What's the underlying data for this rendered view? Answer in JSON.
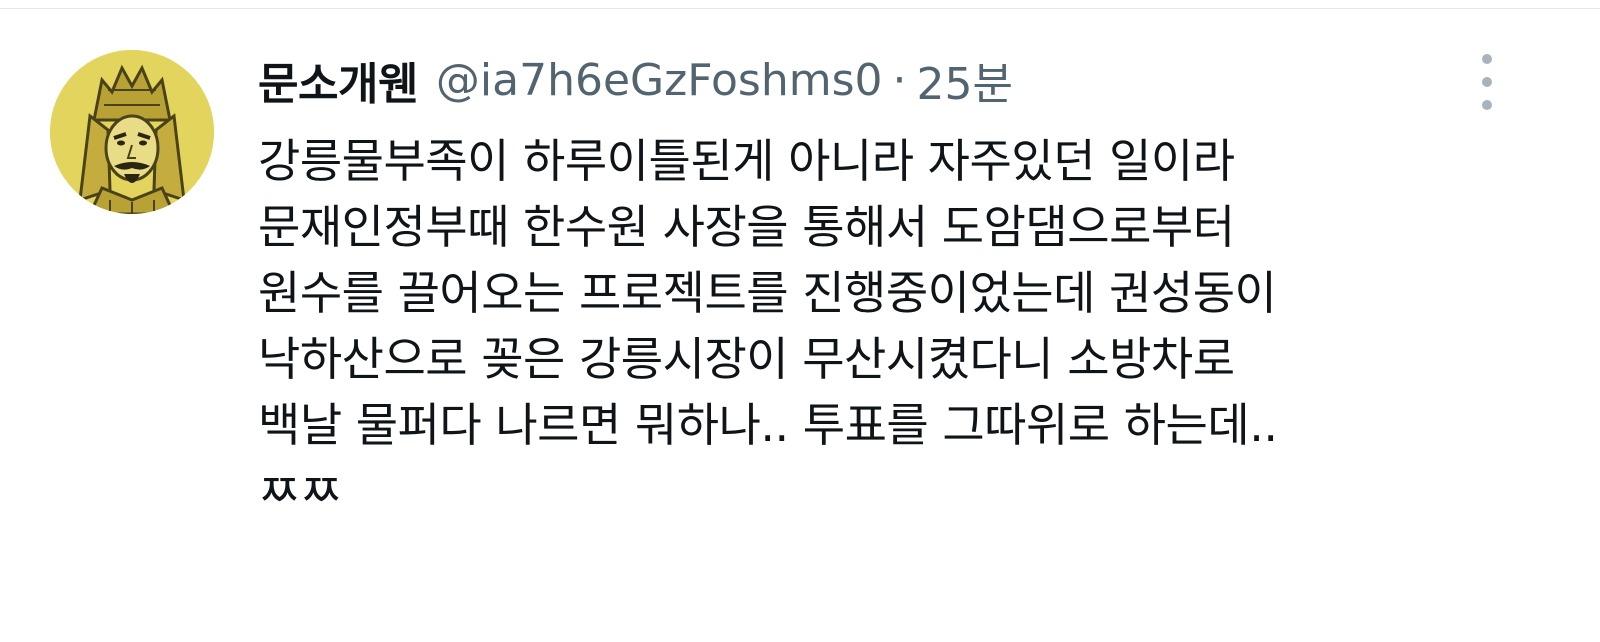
{
  "author": {
    "display_name": "문소개웬",
    "handle": "@ia7h6eGzFoshms0",
    "separator": "·",
    "time": "25분"
  },
  "tweet": {
    "lines": [
      "강릉물부족이 하루이틀된게 아니라 자주있던 일이라",
      "문재인정부때 한수원 사장을 통해서 도암댐으로부터",
      "원수를 끌어오는 프로젝트를 진행중이었는데 권성동이",
      "낙하산으로 꽂은 강릉시장이 무산시켰다니 소방차로",
      "백날 물퍼다 나르면 뭐하나.. 투표를 그따위로 하는데..",
      "ㅉㅉ"
    ]
  },
  "icons": {
    "avatar": "general-portrait-avatar",
    "more": "vertical-dots-more-icon"
  },
  "colors": {
    "text": "#0f1419",
    "secondary": "#536471",
    "avatar_bg": "#e3d45e"
  }
}
